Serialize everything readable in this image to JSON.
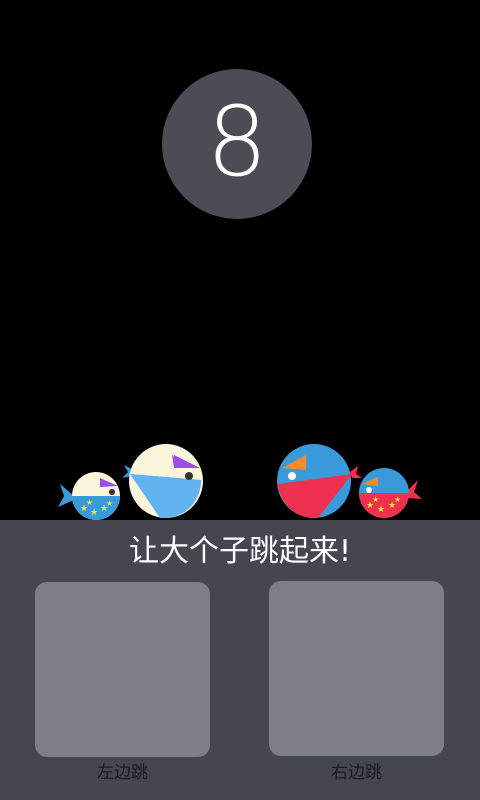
{
  "score": {
    "value": "8"
  },
  "instruction": "让大个子跳起来!",
  "controls": {
    "left_label": "左边跳",
    "right_label": "右边跳"
  },
  "colors": {
    "background": "#000000",
    "score_circle": "#4b4c54",
    "panel": "#45464f",
    "pad": "#7c7f86",
    "bird_cream": "#fbf5dc",
    "bird_blue": "#3a9ad9",
    "bird_red": "#f0304f",
    "accent_purple": "#9b4fe8",
    "accent_orange": "#f28c2a",
    "star_yellow": "#f5e23b"
  },
  "characters": [
    {
      "name": "small-cream-bird",
      "side": "left",
      "size": "small"
    },
    {
      "name": "big-cream-bird",
      "side": "left",
      "size": "big"
    },
    {
      "name": "big-blue-bird",
      "side": "right",
      "size": "big"
    },
    {
      "name": "small-blue-bird",
      "side": "right",
      "size": "small"
    }
  ]
}
